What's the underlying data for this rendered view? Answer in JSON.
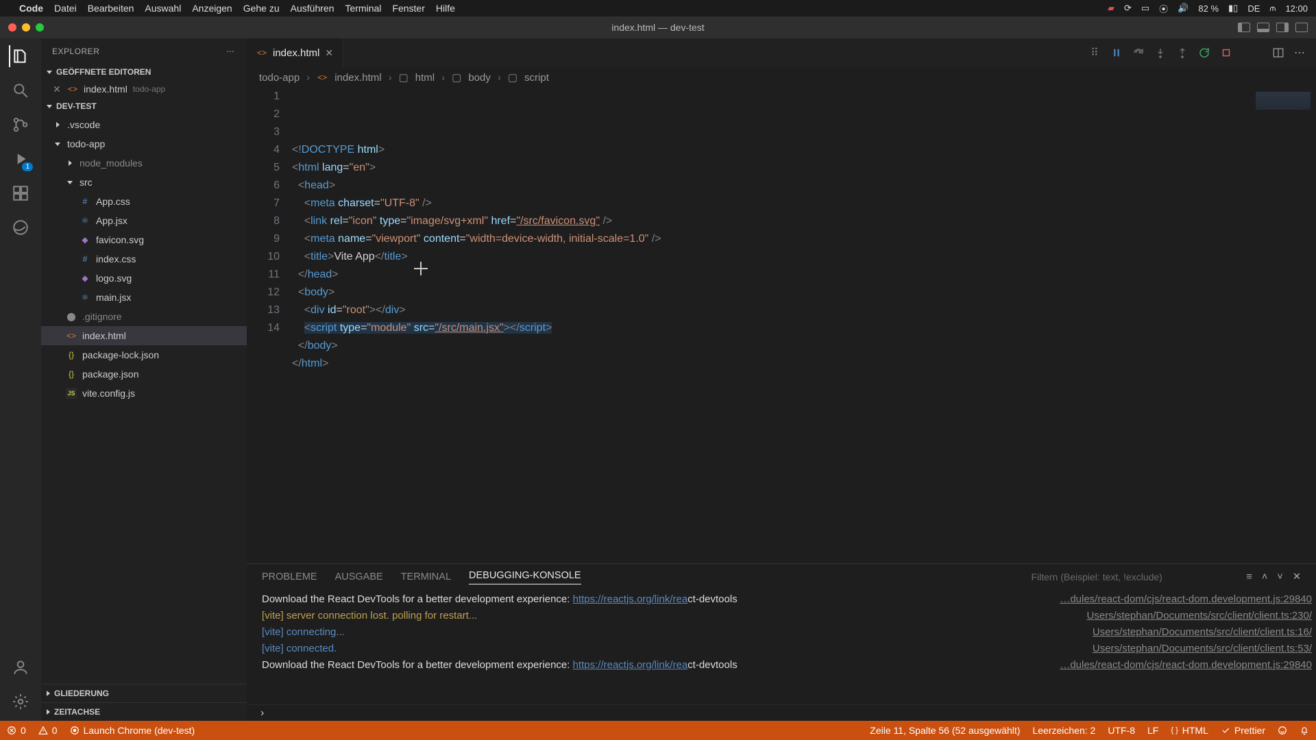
{
  "mac_menu": {
    "apple": "",
    "app": "Code",
    "items": [
      "Datei",
      "Bearbeiten",
      "Auswahl",
      "Anzeigen",
      "Gehe zu",
      "Ausführen",
      "Terminal",
      "Fenster",
      "Hilfe"
    ],
    "battery_pct": "82 %",
    "input_lang": "DE",
    "clock": "12:00"
  },
  "window": {
    "title": "index.html — dev-test"
  },
  "explorer": {
    "title": "EXPLORER",
    "open_editors_label": "GEÖFFNETE EDITOREN",
    "open_editor": {
      "file": "index.html",
      "folder": "todo-app"
    },
    "workspace": "DEV-TEST",
    "tree": {
      "vscode": ".vscode",
      "todo_app": "todo-app",
      "node_modules": "node_modules",
      "src": "src",
      "files_src": [
        "App.css",
        "App.jsx",
        "favicon.svg",
        "index.css",
        "logo.svg",
        "main.jsx"
      ],
      "gitignore": ".gitignore",
      "index_html": "index.html",
      "pkg_lock": "package-lock.json",
      "pkg": "package.json",
      "vite_cfg": "vite.config.js"
    },
    "outline": "GLIEDERUNG",
    "timeline": "ZEITACHSE"
  },
  "activity_badge": "1",
  "tab": {
    "label": "index.html"
  },
  "debug_toolbar": {},
  "breadcrumbs": [
    "todo-app",
    "index.html",
    "html",
    "body",
    "script"
  ],
  "code": {
    "lines": [
      {
        "n": 1,
        "html": "<span class='c-punc'>&lt;!</span><span class='c-doctype'>DOCTYPE</span> <span class='c-attr'>html</span><span class='c-punc'>&gt;</span>"
      },
      {
        "n": 2,
        "html": "<span class='c-punc'>&lt;</span><span class='c-tag'>html</span> <span class='c-attr'>lang</span>=<span class='c-str'>\"en\"</span><span class='c-punc'>&gt;</span>"
      },
      {
        "n": 3,
        "html": "  <span class='c-punc'>&lt;</span><span class='c-tag'>head</span><span class='c-punc'>&gt;</span>"
      },
      {
        "n": 4,
        "html": "    <span class='c-punc'>&lt;</span><span class='c-tag'>meta</span> <span class='c-attr'>charset</span>=<span class='c-str'>\"UTF-8\"</span> <span class='c-punc'>/&gt;</span>"
      },
      {
        "n": 5,
        "html": "    <span class='c-punc'>&lt;</span><span class='c-tag'>link</span> <span class='c-attr'>rel</span>=<span class='c-str'>\"icon\"</span> <span class='c-attr'>type</span>=<span class='c-str'>\"image/svg+xml\"</span> <span class='c-attr'>href</span>=<span class='c-str c-link'>\"/src/favicon.svg\"</span> <span class='c-punc'>/&gt;</span>"
      },
      {
        "n": 6,
        "html": "    <span class='c-punc'>&lt;</span><span class='c-tag'>meta</span> <span class='c-attr'>name</span>=<span class='c-str'>\"viewport\"</span> <span class='c-attr'>content</span>=<span class='c-str'>\"width=device-width, initial-scale=1.0\"</span> <span class='c-punc'>/&gt;</span>"
      },
      {
        "n": 7,
        "html": "    <span class='c-punc'>&lt;</span><span class='c-tag'>title</span><span class='c-punc'>&gt;</span><span class='c-text'>Vite App</span><span class='c-punc'>&lt;/</span><span class='c-tag'>title</span><span class='c-punc'>&gt;</span>"
      },
      {
        "n": 8,
        "html": "  <span class='c-punc'>&lt;/</span><span class='c-tag'>head</span><span class='c-punc'>&gt;</span>"
      },
      {
        "n": 9,
        "html": "  <span class='c-punc'>&lt;</span><span class='c-tag'>body</span><span class='c-punc'>&gt;</span>"
      },
      {
        "n": 10,
        "html": "    <span class='c-punc'>&lt;</span><span class='c-tag'>div</span> <span class='c-attr'>id</span>=<span class='c-str'>\"root\"</span><span class='c-punc'>&gt;&lt;/</span><span class='c-tag'>div</span><span class='c-punc'>&gt;</span>"
      },
      {
        "n": 11,
        "html": "    <span class='hl-line'><span class='c-punc'>&lt;</span><span class='c-tag'>script</span> <span class='c-attr'>type</span>=<span class='c-str'>\"module\"</span> <span class='c-attr'>src</span>=<span class='c-str c-link'>\"/src/main.jsx\"</span><span class='c-punc'>&gt;&lt;/</span><span class='c-tag'>script</span><span class='c-punc'>&gt;</span></span>"
      },
      {
        "n": 12,
        "html": "  <span class='c-punc'>&lt;/</span><span class='c-tag'>body</span><span class='c-punc'>&gt;</span>"
      },
      {
        "n": 13,
        "html": "<span class='c-punc'>&lt;/</span><span class='c-tag'>html</span><span class='c-punc'>&gt;</span>"
      },
      {
        "n": 14,
        "html": ""
      }
    ]
  },
  "panel": {
    "tabs": {
      "problems": "PROBLEME",
      "output": "AUSGABE",
      "terminal": "TERMINAL",
      "debug": "DEBUGGING-KONSOLE"
    },
    "filter_placeholder": "Filtern (Beispiel: text, !exclude)",
    "lines": [
      {
        "msg_html": "<span class='cl-white'>Download the React DevTools for a better development experience: </span><span class='cl-url'>https://reactjs.org/link/rea</span><span class='cl-white'>ct-devtools</span>",
        "src": "…dules/react-dom/cjs/react-dom.development.js:29840"
      },
      {
        "msg_html": "<span class='cl-yellow'>[vite] server connection lost. polling for restart...</span>",
        "src": "Users/stephan/Documents/src/client/client.ts:230/"
      },
      {
        "msg_html": "<span class='cl-blue'>[vite] connecting...</span>",
        "src": "Users/stephan/Documents/src/client/client.ts:16/"
      },
      {
        "msg_html": "<span class='cl-blue'>[vite] connected.</span>",
        "src": "Users/stephan/Documents/src/client/client.ts:53/"
      },
      {
        "msg_html": "<span class='cl-white'>Download the React DevTools for a better development experience: </span><span class='cl-url'>https://reactjs.org/link/rea</span><span class='cl-white'>ct-devtools</span>",
        "src": "…dules/react-dom/cjs/react-dom.development.js:29840"
      }
    ]
  },
  "cmd_prompt": "›",
  "status": {
    "errors": "0",
    "warnings": "0",
    "launch": "Launch Chrome (dev-test)",
    "cursor": "Zeile 11, Spalte 56 (52 ausgewählt)",
    "spaces": "Leerzeichen: 2",
    "encoding": "UTF-8",
    "eol": "LF",
    "lang": "HTML",
    "prettier": "Prettier"
  }
}
